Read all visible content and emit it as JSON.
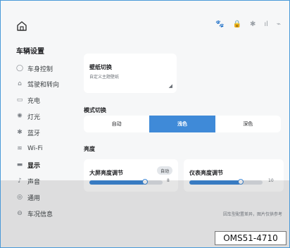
{
  "header": {
    "home_icon": "home-icon",
    "status": {
      "icons": [
        "paw-icon",
        "lock-icon",
        "bluetooth-icon",
        "signal-icon",
        "wifi-icon"
      ],
      "texts": [
        "🐾",
        "🔒",
        "✱",
        "ıl",
        "⌁"
      ]
    }
  },
  "sidebar": {
    "title": "车辆设置",
    "items": [
      {
        "label": "车身控制",
        "icon": "car-body-icon",
        "glyph": "◯"
      },
      {
        "label": "驾驶和转向",
        "icon": "steering-icon",
        "glyph": "⌂"
      },
      {
        "label": "充电",
        "icon": "charge-icon",
        "glyph": "▭"
      },
      {
        "label": "灯光",
        "icon": "light-icon",
        "glyph": "✺"
      },
      {
        "label": "蓝牙",
        "icon": "bluetooth-icon",
        "glyph": "✱"
      },
      {
        "label": "Wi-Fi",
        "icon": "wifi-icon",
        "glyph": "≋"
      },
      {
        "label": "显示",
        "icon": "display-icon",
        "glyph": "▬",
        "active": true
      },
      {
        "label": "声音",
        "icon": "sound-icon",
        "glyph": "♪"
      },
      {
        "label": "通用",
        "icon": "general-icon",
        "glyph": "◎"
      },
      {
        "label": "车况信息",
        "icon": "info-icon",
        "glyph": "⊖"
      }
    ]
  },
  "main": {
    "wallpaper": {
      "title": "壁纸切换",
      "subtitle": "自定义主题壁纸",
      "resize_icon": "resize-icon",
      "resize_glyph": "◢"
    },
    "mode": {
      "label": "模式切换",
      "options": [
        "自动",
        "浅色",
        "深色"
      ],
      "selected": "浅色"
    },
    "brightness": {
      "label": "亮度",
      "screen": {
        "title": "大屏亮度调节",
        "auto_label": "自动",
        "value": "8",
        "fraction": 0.76
      },
      "cluster": {
        "title": "仪表亮度调节",
        "value": "10",
        "fraction": 0.7
      }
    }
  },
  "footer": {
    "note": "因车型配置差异，图片仅供参考",
    "code": "OMS51-4710"
  },
  "colors": {
    "accent": "#3f8ad8",
    "status_accent": "#f0a030"
  }
}
